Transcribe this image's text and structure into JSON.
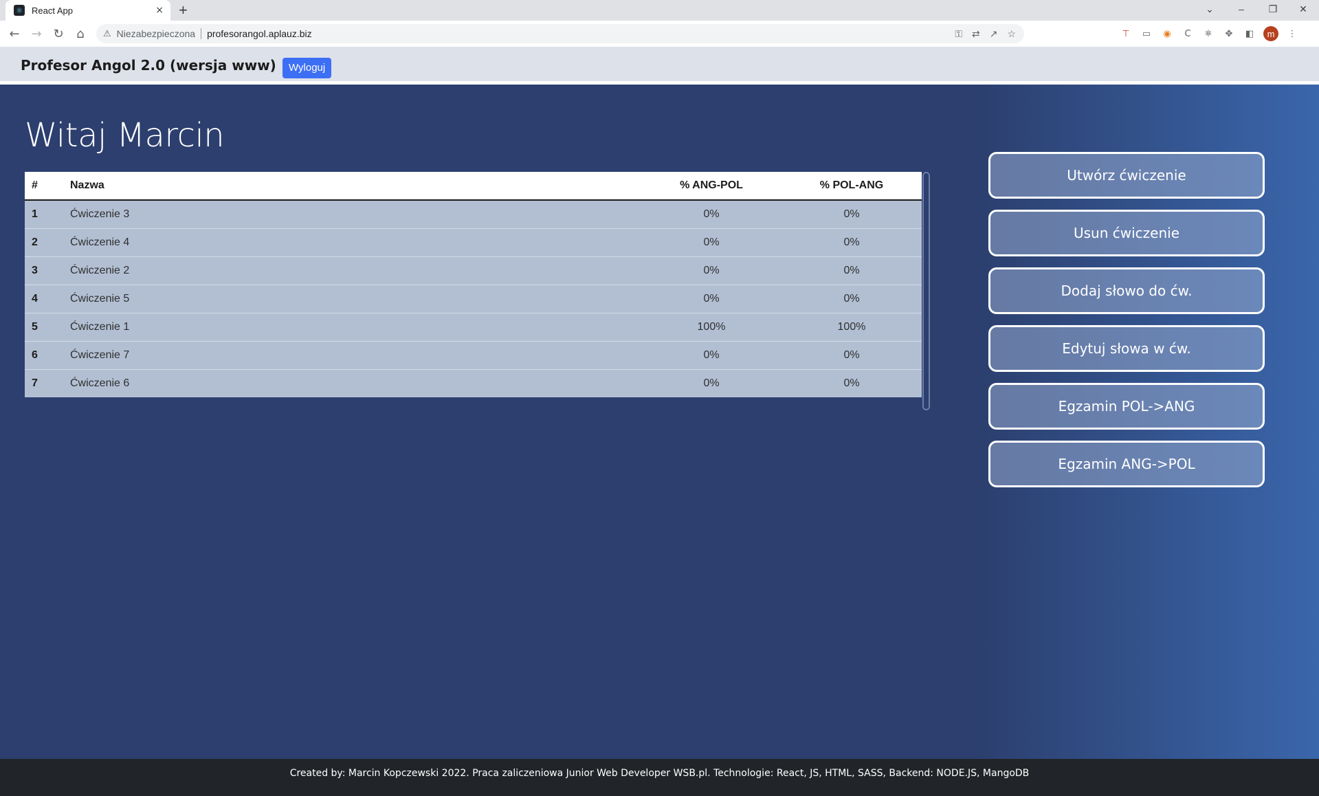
{
  "browser": {
    "tab_title": "React App",
    "tab_close": "×",
    "new_tab": "+",
    "security_label": "Niezabezpieczona",
    "url": "profesorangol.aplauz.biz",
    "profile_initial": "m",
    "window_controls": {
      "minimize": "–",
      "restore": "❐",
      "close": "✕",
      "tab_search": "⌄"
    }
  },
  "header": {
    "title": "Profesor Angol 2.0 (wersja www)",
    "logout_label": "Wyloguj"
  },
  "main": {
    "welcome": "Witaj Marcin",
    "table": {
      "columns": [
        "#",
        "Nazwa",
        "% ANG-POL",
        "% POL-ANG"
      ],
      "rows": [
        {
          "num": "1",
          "name": "Ćwiczenie 3",
          "ang_pol": "0%",
          "pol_ang": "0%"
        },
        {
          "num": "2",
          "name": "Ćwiczenie 4",
          "ang_pol": "0%",
          "pol_ang": "0%"
        },
        {
          "num": "3",
          "name": "Ćwiczenie 2",
          "ang_pol": "0%",
          "pol_ang": "0%"
        },
        {
          "num": "4",
          "name": "Ćwiczenie 5",
          "ang_pol": "0%",
          "pol_ang": "0%"
        },
        {
          "num": "5",
          "name": "Ćwiczenie 1",
          "ang_pol": "100%",
          "pol_ang": "100%"
        },
        {
          "num": "6",
          "name": "Ćwiczenie 7",
          "ang_pol": "0%",
          "pol_ang": "0%"
        },
        {
          "num": "7",
          "name": "Ćwiczenie 6",
          "ang_pol": "0%",
          "pol_ang": "0%"
        }
      ]
    },
    "actions": {
      "create": "Utwórz ćwiczenie",
      "delete": "Usun ćwiczenie",
      "add_word": "Dodaj słowo do ćw.",
      "edit_words": "Edytuj słowa w ćw.",
      "exam_pol_ang": "Egzamin POL->ANG",
      "exam_ang_pol": "Egzamin ANG->POL"
    }
  },
  "footer": {
    "text": "Created by: Marcin Kopczewski 2022. Praca zaliczeniowa Junior Web Developer WSB.pl. Technologie: React, JS, HTML, SASS, Backend: NODE.JS, MangoDB"
  }
}
